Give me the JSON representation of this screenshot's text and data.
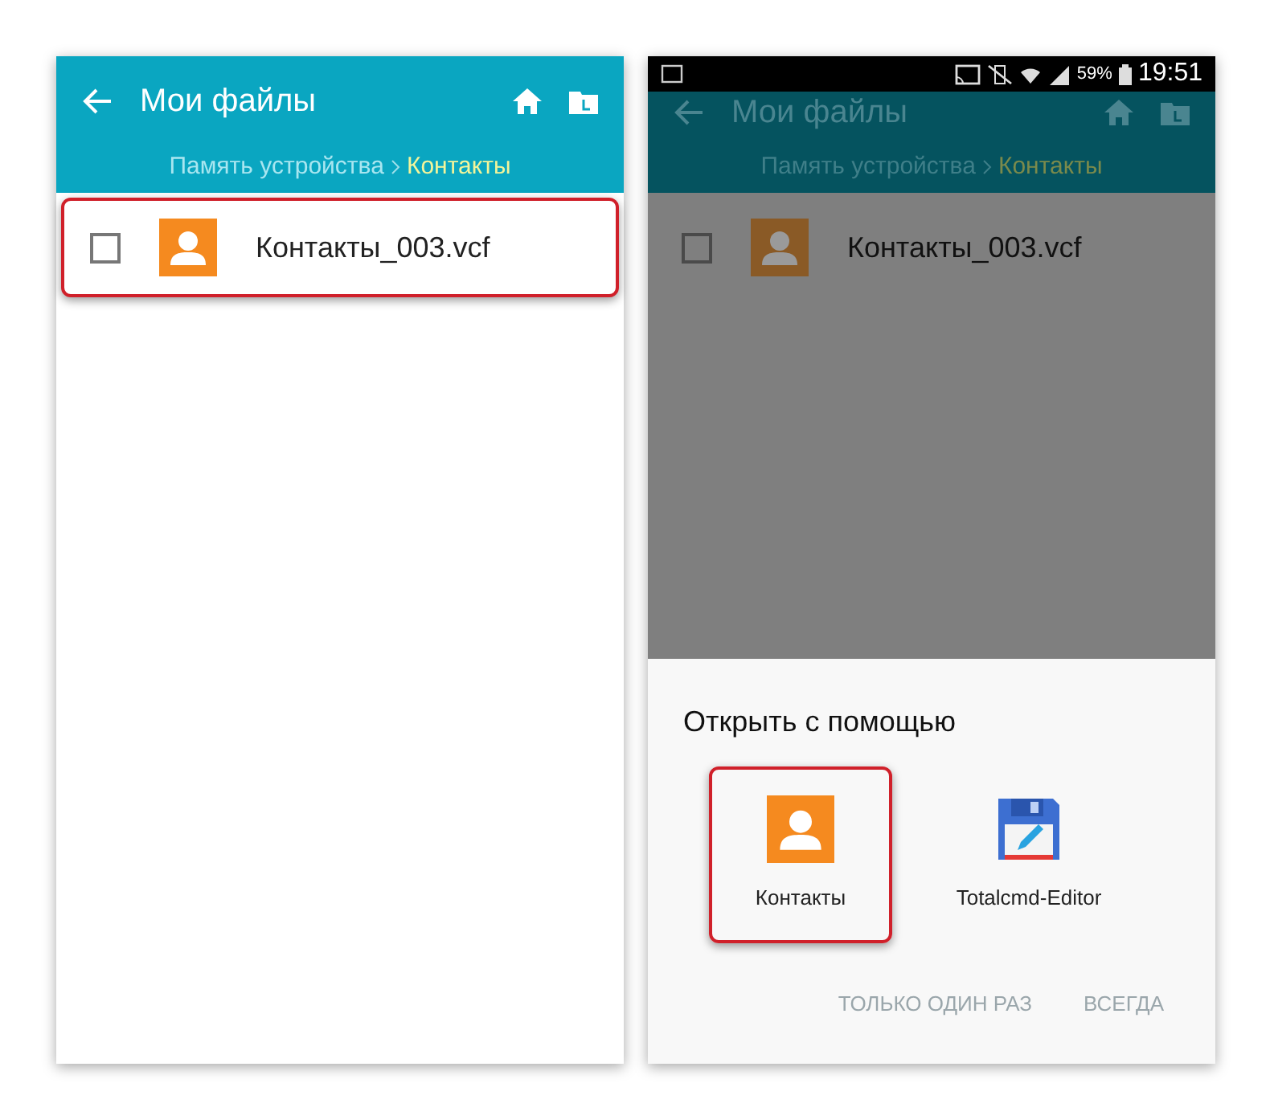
{
  "screens": [
    {
      "dimmed": false,
      "title": "Мои файлы",
      "breadcrumb": [
        {
          "label": "Память устройства",
          "current": false
        },
        {
          "label": "Контакты",
          "current": true
        }
      ],
      "files": [
        {
          "name": "Контакты_003.vcf",
          "checked": false,
          "highlighted": true
        }
      ]
    },
    {
      "dimmed": true,
      "status_bar": {
        "battery": "59%",
        "time": "19:51"
      },
      "title": "Мои файлы",
      "breadcrumb": [
        {
          "label": "Память устройства",
          "current": false
        },
        {
          "label": "Контакты",
          "current": true
        }
      ],
      "files": [
        {
          "name": "Контакты_003.vcf",
          "checked": false,
          "highlighted": false
        }
      ],
      "dialog": {
        "title": "Открыть с помощью",
        "apps": [
          {
            "kind": "contacts",
            "name": "Контакты",
            "highlighted": true
          },
          {
            "kind": "editor",
            "name": "Totalcmd-Editor",
            "highlighted": false
          }
        ],
        "buttons": [
          {
            "label": "ТОЛЬКО ОДИН РАЗ",
            "disabled": true
          },
          {
            "label": "ВСЕГДА",
            "disabled": true
          }
        ]
      }
    }
  ]
}
